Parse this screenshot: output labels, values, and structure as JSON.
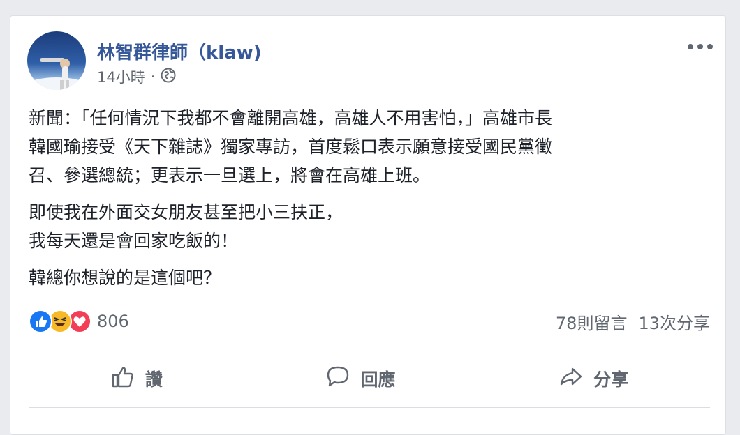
{
  "post": {
    "author": "林智群律師（klaw)",
    "time": "14小時",
    "separator": "·",
    "paragraphs": [
      "新聞：「任何情況下我都不會離開高雄，高雄人不用害怕，」高雄市長\n韓國瑜接受《天下雜誌》獨家專訪，首度鬆口表示願意接受國民黨徵\n召、參選總統；更表示一旦選上，將會在高雄上班。",
      "即使我在外面交女朋友甚至把小三扶正，\n我每天還是會回家吃飯的！",
      "韓總你想說的是這個吧？"
    ],
    "reaction_count": "806",
    "comments": "78則留言",
    "shares": "13次分享"
  },
  "actions": {
    "like": "讚",
    "comment": "回應",
    "share": "分享"
  },
  "icons": [
    "globe-icon",
    "more-icon",
    "like-reaction-icon",
    "haha-reaction-icon",
    "love-reaction-icon",
    "thumbs-up-icon",
    "comment-icon",
    "share-icon"
  ],
  "colors": {
    "author": "#365899",
    "like": "#1877f2",
    "haha": "#f7b928",
    "love": "#f33e58",
    "muted": "#606770"
  }
}
